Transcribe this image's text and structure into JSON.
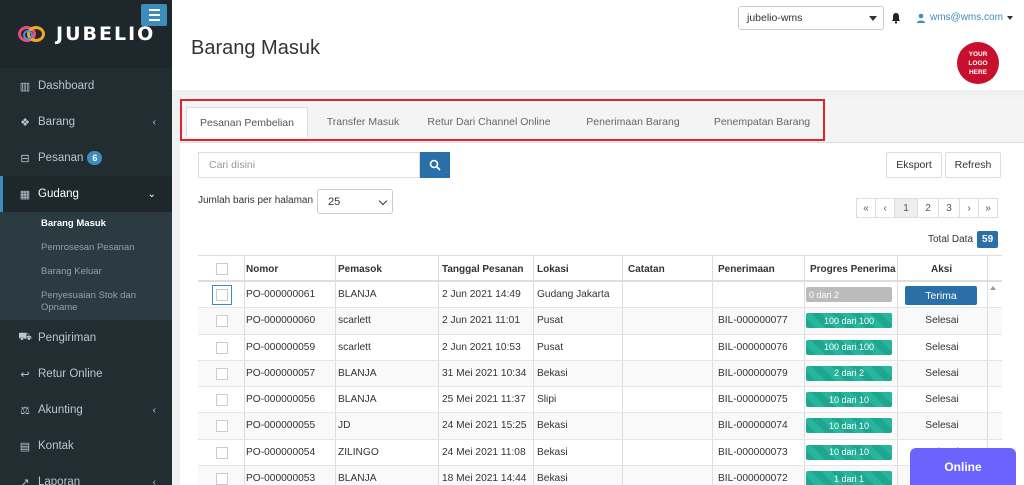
{
  "brand": {
    "name": "JUBELIO"
  },
  "sidebar": {
    "items": [
      {
        "label": "Dashboard",
        "icon": "chart-icon"
      },
      {
        "label": "Barang",
        "icon": "cubes-icon",
        "chevron": "‹"
      },
      {
        "label": "Pesanan",
        "icon": "cart-icon",
        "badge": "6"
      },
      {
        "label": "Gudang",
        "icon": "building-icon",
        "chevron": "⌄"
      },
      {
        "label": "Pengiriman",
        "icon": "truck-icon"
      },
      {
        "label": "Retur Online",
        "icon": "reply-icon"
      },
      {
        "label": "Akunting",
        "icon": "scale-icon",
        "chevron": "‹"
      },
      {
        "label": "Kontak",
        "icon": "id-card-icon"
      },
      {
        "label": "Laporan",
        "icon": "line-chart-icon",
        "chevron": "‹"
      }
    ],
    "gudang_sub": [
      "Barang Masuk",
      "Pemrosesan Pesanan",
      "Barang Keluar",
      "Penyesuaian Stok dan Opname"
    ]
  },
  "header": {
    "title": "Barang Masuk",
    "warehouse": "jubelio-wms",
    "user": "wms@wms.com",
    "logo_text": [
      "YOUR",
      "LOGO",
      "HERE"
    ]
  },
  "tabs": [
    "Pesanan Pembelian",
    "Transfer Masuk",
    "Retur Dari Channel Online",
    "Penerimaan Barang",
    "Penempatan Barang"
  ],
  "toolbar": {
    "search_placeholder": "Cari disini",
    "export_label": "Eksport",
    "refresh_label": "Refresh",
    "rows_label": "Jumlah baris per halaman",
    "rows_value": "25",
    "total_label": "Total Data",
    "total_value": "59"
  },
  "pager": [
    "«",
    "‹",
    "1",
    "2",
    "3",
    "›",
    "»"
  ],
  "table": {
    "headers": [
      "Nomor",
      "Pemasok",
      "Tanggal Pesanan",
      "Lokasi",
      "Catatan",
      "Penerimaan",
      "Progres Penerima",
      "Aksi"
    ],
    "rows": [
      {
        "nomor": "PO-000000061",
        "pemasok": "BLANJA",
        "tanggal": "2 Jun 2021 14:49",
        "lokasi": "Gudang Jakarta",
        "catatan": "",
        "penerimaan": "",
        "progres": "0 dari 2",
        "progress_ratio": 0,
        "aksi": "Terima"
      },
      {
        "nomor": "PO-000000060",
        "pemasok": "scarlett",
        "tanggal": "2 Jun 2021 11:01",
        "lokasi": "Pusat",
        "catatan": "",
        "penerimaan": "BIL-000000077",
        "progres": "100 dari 100",
        "progress_ratio": 1,
        "aksi": "Selesai"
      },
      {
        "nomor": "PO-000000059",
        "pemasok": "scarlett",
        "tanggal": "2 Jun 2021 10:53",
        "lokasi": "Pusat",
        "catatan": "",
        "penerimaan": "BIL-000000076",
        "progres": "100 dari 100",
        "progress_ratio": 1,
        "aksi": "Selesai"
      },
      {
        "nomor": "PO-000000057",
        "pemasok": "BLANJA",
        "tanggal": "31 Mei 2021 10:34",
        "lokasi": "Bekasi",
        "catatan": "",
        "penerimaan": "BIL-000000079",
        "progres": "2 dari 2",
        "progress_ratio": 1,
        "aksi": "Selesai"
      },
      {
        "nomor": "PO-000000056",
        "pemasok": "BLANJA",
        "tanggal": "25 Mei 2021 11:37",
        "lokasi": "Slipi",
        "catatan": "",
        "penerimaan": "BIL-000000075",
        "progres": "10 dari 10",
        "progress_ratio": 1,
        "aksi": "Selesai"
      },
      {
        "nomor": "PO-000000055",
        "pemasok": "JD",
        "tanggal": "24 Mei 2021 15:25",
        "lokasi": "Bekasi",
        "catatan": "",
        "penerimaan": "BIL-000000074",
        "progres": "10 dari 10",
        "progress_ratio": 1,
        "aksi": "Selesai"
      },
      {
        "nomor": "PO-000000054",
        "pemasok": "ZILINGO",
        "tanggal": "24 Mei 2021 11:08",
        "lokasi": "Bekasi",
        "catatan": "",
        "penerimaan": "BIL-000000073",
        "progres": "10 dari 10",
        "progress_ratio": 1,
        "aksi": "Selesai"
      },
      {
        "nomor": "PO-000000053",
        "pemasok": "BLANJA",
        "tanggal": "18 Mei 2021 14:44",
        "lokasi": "Bekasi",
        "catatan": "",
        "penerimaan": "BIL-000000072",
        "progres": "1 dari 1",
        "progress_ratio": 1,
        "aksi": "Selesai"
      }
    ]
  },
  "chat": {
    "label": "Online"
  },
  "colors": {
    "sidebar": "#222d32",
    "accent": "#2a6fa8",
    "progress": "#1fa68f",
    "highlight": "#e0232b",
    "chat": "#6c63ff"
  }
}
